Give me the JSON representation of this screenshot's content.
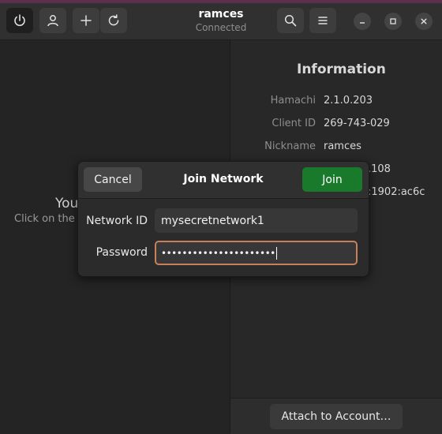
{
  "header": {
    "title": "ramces",
    "status": "Connected",
    "buttons": {
      "power": "power-icon",
      "user": "user-icon",
      "add": "plus-icon",
      "refresh": "refresh-icon",
      "search": "search-icon",
      "menu": "menu-icon"
    },
    "window_controls": [
      "minimize-icon",
      "maximize-icon",
      "close-icon"
    ]
  },
  "left_pane": {
    "title_partial": "You",
    "subtitle_partial": "Click on the"
  },
  "info": {
    "title": "Information",
    "rows": [
      {
        "label": "Hamachi",
        "value": "2.1.0.203"
      },
      {
        "label": "Client ID",
        "value": "269-743-029"
      },
      {
        "label": "Nickname",
        "value": "ramces"
      },
      {
        "label": "",
        "value": ".108"
      },
      {
        "label": "",
        "value": ":1902:ac6c"
      }
    ]
  },
  "bottom_bar": {
    "attach_label": "Attach to Account…"
  },
  "dialog": {
    "title": "Join Network",
    "cancel_label": "Cancel",
    "join_label": "Join",
    "network_id_label": "Network ID",
    "network_id_value": "mysecretnetwork1",
    "password_label": "Password",
    "password_value": "••••••••••••••••••••••"
  },
  "colors": {
    "join_button": "#1a7a2c",
    "focus_border": "#c7805a",
    "top_accent": "#5c2f4e"
  }
}
